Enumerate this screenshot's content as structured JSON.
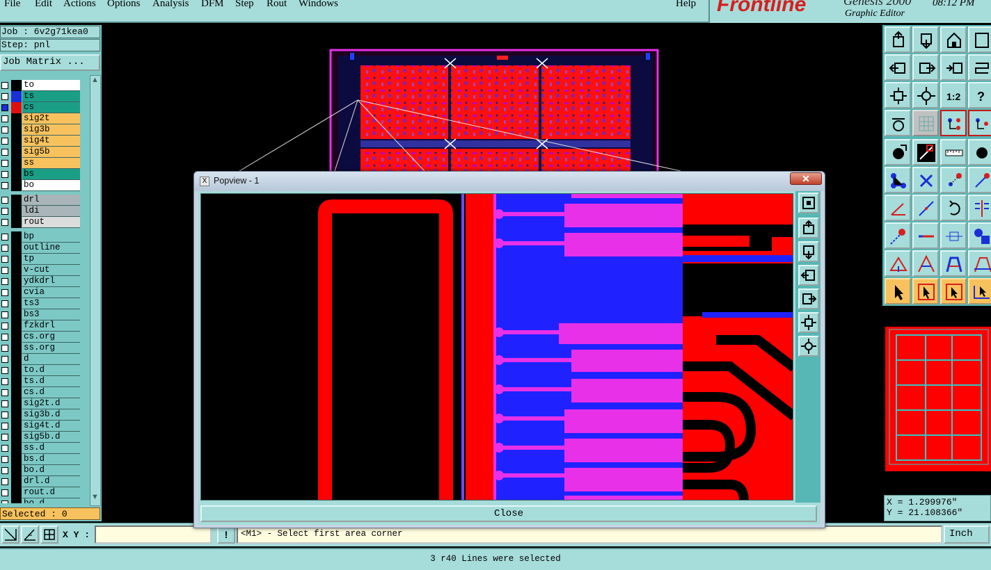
{
  "menu": {
    "file": "File",
    "edit": "Edit",
    "actions": "Actions",
    "options": "Options",
    "analysis": "Analysis",
    "dfm": "DFM",
    "step": "Step",
    "rout": "Rout",
    "windows": "Windows",
    "help": "Help"
  },
  "brand": {
    "logo": "Frontline",
    "product": "Genesis 2000",
    "subtitle": "Graphic Editor",
    "time": "08:12 PM"
  },
  "job": {
    "job_label": "Job : 6v2g71kea0",
    "step_label": "Step: pnl",
    "matrix_button": "Job Matrix ..."
  },
  "layers": [
    {
      "name": "to",
      "color": "#ffffff",
      "checked": false,
      "swatch": "#000000"
    },
    {
      "name": "ts",
      "color": "#1a9f86",
      "checked": false,
      "swatch": "#1b2fd6"
    },
    {
      "name": "cs",
      "color": "#1a9f86",
      "checked": true,
      "swatch": "#e01010"
    },
    {
      "name": "sig2t",
      "color": "#f7c25e",
      "checked": false,
      "swatch": "#000000"
    },
    {
      "name": "sig3b",
      "color": "#f7c25e",
      "checked": false,
      "swatch": "#000000"
    },
    {
      "name": "sig4t",
      "color": "#f7c25e",
      "checked": false,
      "swatch": "#000000"
    },
    {
      "name": "sig5b",
      "color": "#f7c25e",
      "checked": false,
      "swatch": "#000000"
    },
    {
      "name": "ss",
      "color": "#f7c25e",
      "checked": false,
      "swatch": "#000000"
    },
    {
      "name": "bs",
      "color": "#1a9f86",
      "checked": false,
      "swatch": "#000000"
    },
    {
      "name": "bo",
      "color": "#ffffff",
      "checked": false,
      "swatch": "#000000"
    },
    {
      "name": "drl",
      "color": "#a9b5b8",
      "checked": false,
      "swatch": "#000000"
    },
    {
      "name": "ldi",
      "color": "#a9b5b8",
      "checked": false,
      "swatch": "#000000"
    },
    {
      "name": "rout",
      "color": "#dcdcdc",
      "checked": false,
      "swatch": "#000000"
    },
    {
      "name": "bp",
      "color": "#7cc8c5",
      "checked": false,
      "swatch": "#000000"
    },
    {
      "name": "outline",
      "color": "#7cc8c5",
      "checked": false,
      "swatch": "#000000"
    },
    {
      "name": "tp",
      "color": "#7cc8c5",
      "checked": false,
      "swatch": "#000000"
    },
    {
      "name": "v-cut",
      "color": "#7cc8c5",
      "checked": false,
      "swatch": "#000000"
    },
    {
      "name": "ydkdrl",
      "color": "#7cc8c5",
      "checked": false,
      "swatch": "#000000"
    },
    {
      "name": "cvia",
      "color": "#7cc8c5",
      "checked": false,
      "swatch": "#000000"
    },
    {
      "name": "ts3",
      "color": "#7cc8c5",
      "checked": false,
      "swatch": "#000000"
    },
    {
      "name": "bs3",
      "color": "#7cc8c5",
      "checked": false,
      "swatch": "#000000"
    },
    {
      "name": "fzkdrl",
      "color": "#7cc8c5",
      "checked": false,
      "swatch": "#000000"
    },
    {
      "name": "cs.org",
      "color": "#7cc8c5",
      "checked": false,
      "swatch": "#000000"
    },
    {
      "name": "ss.org",
      "color": "#7cc8c5",
      "checked": false,
      "swatch": "#000000"
    },
    {
      "name": "d",
      "color": "#7cc8c5",
      "checked": false,
      "swatch": "#000000"
    },
    {
      "name": "to.d",
      "color": "#7cc8c5",
      "checked": false,
      "swatch": "#000000"
    },
    {
      "name": "ts.d",
      "color": "#7cc8c5",
      "checked": false,
      "swatch": "#000000"
    },
    {
      "name": "cs.d",
      "color": "#7cc8c5",
      "checked": false,
      "swatch": "#000000"
    },
    {
      "name": "sig2t.d",
      "color": "#7cc8c5",
      "checked": false,
      "swatch": "#000000"
    },
    {
      "name": "sig3b.d",
      "color": "#7cc8c5",
      "checked": false,
      "swatch": "#000000"
    },
    {
      "name": "sig4t.d",
      "color": "#7cc8c5",
      "checked": false,
      "swatch": "#000000"
    },
    {
      "name": "sig5b.d",
      "color": "#7cc8c5",
      "checked": false,
      "swatch": "#000000"
    },
    {
      "name": "ss.d",
      "color": "#7cc8c5",
      "checked": false,
      "swatch": "#000000"
    },
    {
      "name": "bs.d",
      "color": "#7cc8c5",
      "checked": false,
      "swatch": "#000000"
    },
    {
      "name": "bo.d",
      "color": "#7cc8c5",
      "checked": false,
      "swatch": "#000000"
    },
    {
      "name": "drl.d",
      "color": "#7cc8c5",
      "checked": false,
      "swatch": "#000000"
    },
    {
      "name": "rout.d",
      "color": "#7cc8c5",
      "checked": false,
      "swatch": "#000000"
    },
    {
      "name": "bo.d",
      "color": "#7cc8c5",
      "checked": false,
      "swatch": "#000000"
    }
  ],
  "selected_label": "Selected : 0",
  "coords": {
    "x": "X =  1.299976\"",
    "y": "Y = 21.108366\""
  },
  "popview": {
    "title": "Popview - 1",
    "close_button": "Close",
    "close_glyph": "✕",
    "icon_glyph": "X"
  },
  "command": {
    "xy_label": "X Y :",
    "xy_value": "",
    "prompt_icon": "!",
    "prompt": "<M1> - Select first area corner",
    "units": "Inch"
  },
  "status_message": "3 r40 Lines were selected",
  "colors": {
    "panel": "#a6dcda",
    "accent_red": "#ff0000",
    "accent_blue": "#1f22ff",
    "accent_magenta": "#e830e8"
  }
}
